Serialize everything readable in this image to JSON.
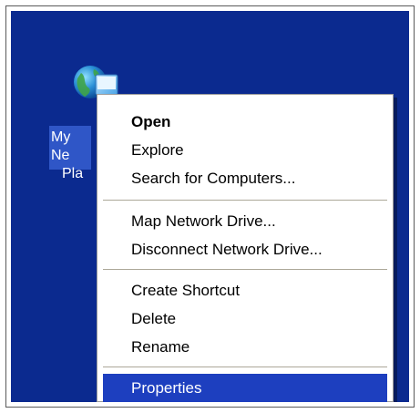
{
  "desktop": {
    "background_color": "#0b2a8f",
    "icon": {
      "name": "my-network-places-icon",
      "label_line1": "My Ne",
      "label_line2": "Pla"
    }
  },
  "context_menu": {
    "items": [
      {
        "label": "Open",
        "bold": true
      },
      {
        "label": "Explore"
      },
      {
        "label": "Search for Computers..."
      },
      {
        "label": "Map Network Drive..."
      },
      {
        "label": "Disconnect Network Drive..."
      },
      {
        "label": "Create Shortcut"
      },
      {
        "label": "Delete"
      },
      {
        "label": "Rename"
      },
      {
        "label": "Properties",
        "selected": true
      }
    ],
    "selection_color": "#1d3fbf"
  }
}
